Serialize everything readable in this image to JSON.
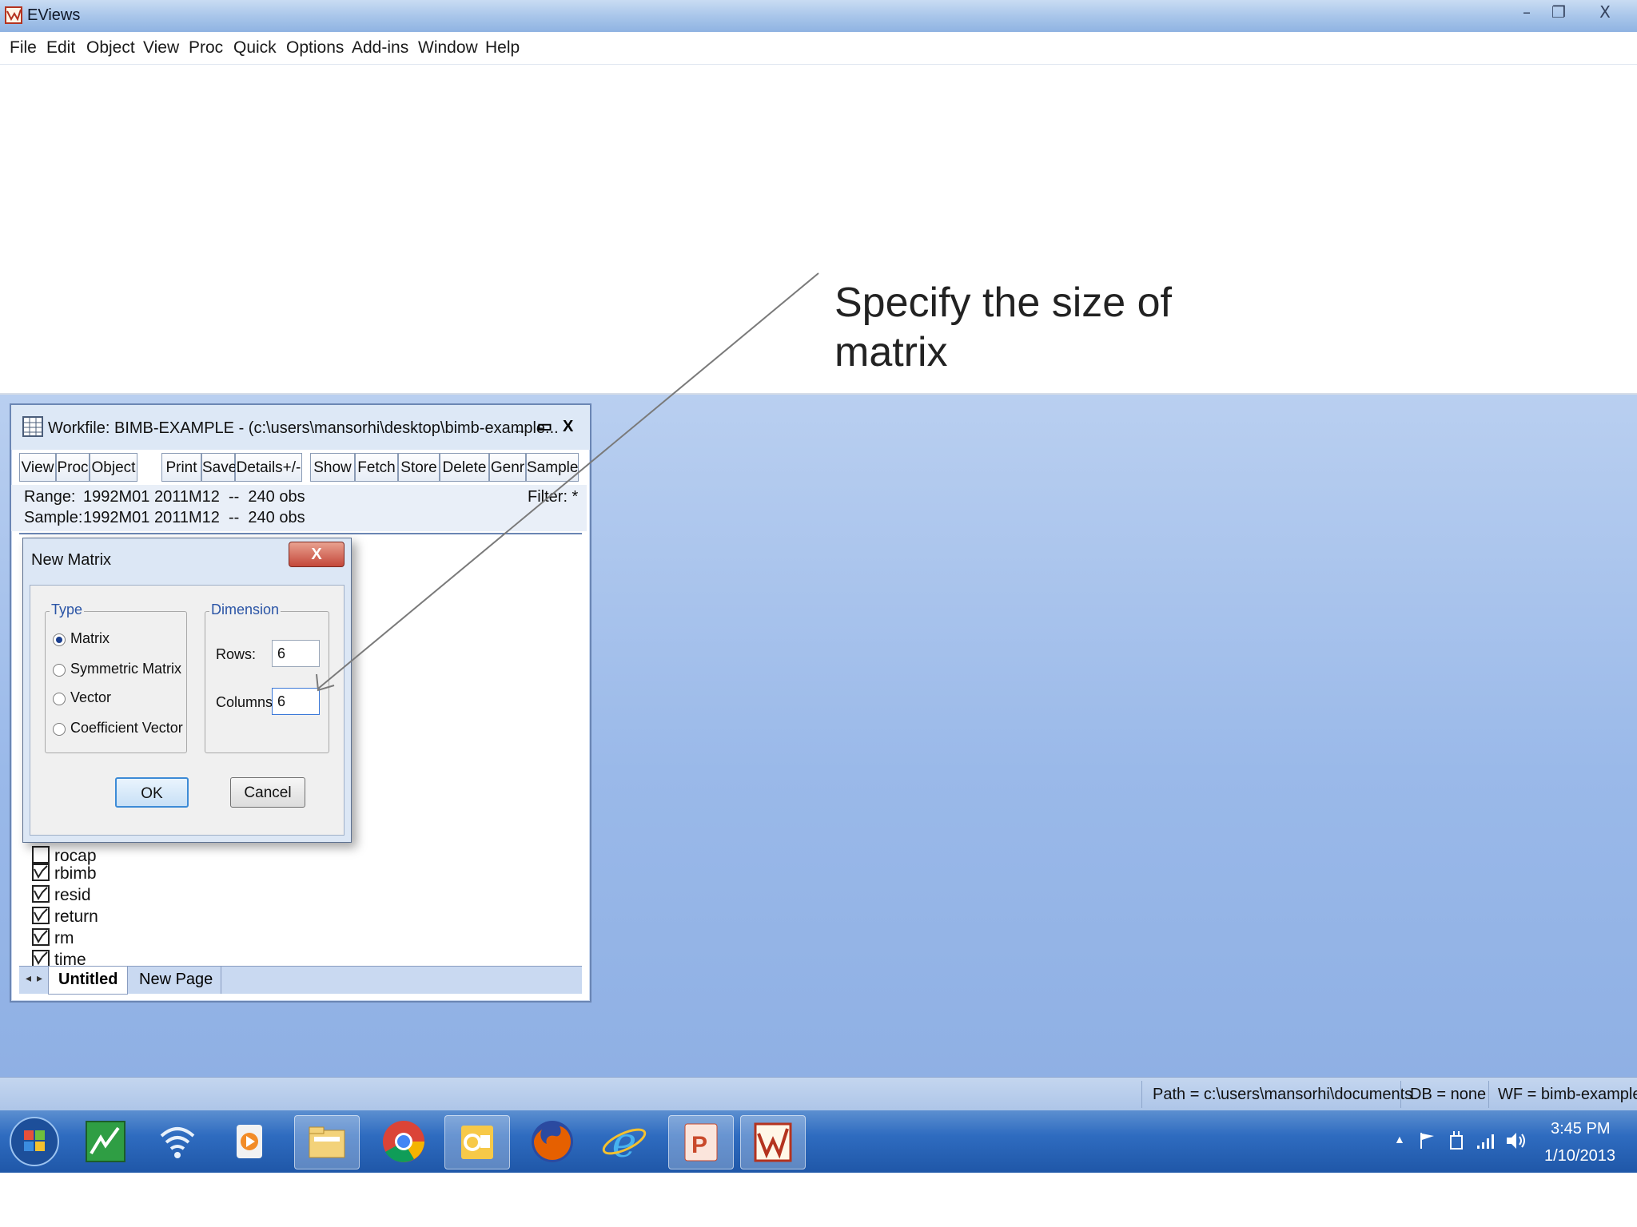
{
  "app": {
    "title": "EViews",
    "minimize": "–",
    "restore": "❐",
    "close": "X"
  },
  "menu": [
    "File",
    "Edit",
    "Object",
    "View",
    "Proc",
    "Quick",
    "Options",
    "Add-ins",
    "Window",
    "Help"
  ],
  "annotation": {
    "line1": "Specify the size of",
    "line2": "matrix"
  },
  "workfile": {
    "title": "Workfile: BIMB-EXAMPLE - (c:\\users\\mansorhi\\desktop\\bimb-example...",
    "min": "_",
    "max": "▭",
    "close": "X",
    "toolbar": [
      "View",
      "Proc",
      "Object",
      "Print",
      "Save",
      "Details+/-",
      "Show",
      "Fetch",
      "Store",
      "Delete",
      "Genr",
      "Sample"
    ],
    "range_label": "Range:",
    "range_value": "1992M01 2011M12  --  240 obs",
    "sample_label": "Sample:",
    "sample_value": "1992M01 2011M12  --  240 obs",
    "filter": "Filter: *",
    "items_partial": "rocap",
    "items": [
      "rbimb",
      "resid",
      "return",
      "rm",
      "time"
    ],
    "tabs": [
      "Untitled",
      "New Page"
    ]
  },
  "dialog": {
    "title": "New Matrix",
    "close": "X",
    "type_group": "Type",
    "type_options": [
      "Matrix",
      "Symmetric Matrix",
      "Vector",
      "Coefficient Vector"
    ],
    "selected_type": "Matrix",
    "dimension_group": "Dimension",
    "rows_label": "Rows:",
    "rows_value": "6",
    "columns_label": "Columns:",
    "columns_value": "6",
    "ok": "OK",
    "cancel": "Cancel"
  },
  "statusbar": {
    "path": "Path = c:\\users\\mansorhi\\documents",
    "db": "DB = none",
    "wf": "WF = bimb-example"
  },
  "taskbar": {
    "icons": [
      "start-orb-icon",
      "eviews-green-icon",
      "wifi-icon",
      "media-player-icon",
      "file-explorer-icon",
      "chrome-icon",
      "outlook-icon",
      "firefox-icon",
      "internet-explorer-icon",
      "powerpoint-icon",
      "eviews-icon"
    ],
    "time": "3:45 PM",
    "date": "1/10/2013"
  },
  "colors": {
    "desktop_blue": "#9ab9e9",
    "taskbar_blue": "#2f6cc0",
    "dialog_close_red": "#c4483a"
  }
}
